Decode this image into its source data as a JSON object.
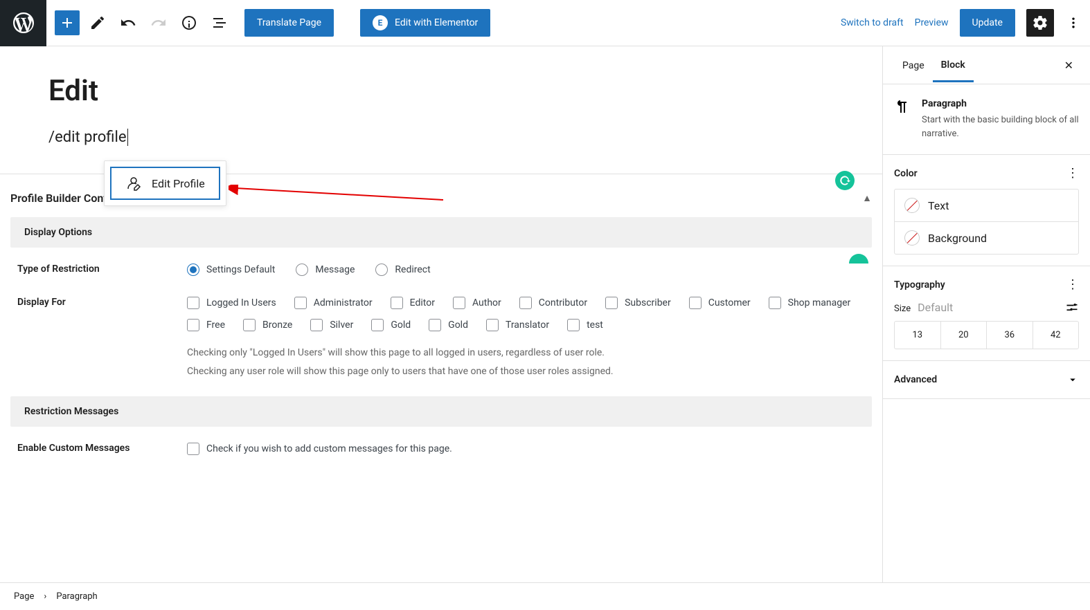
{
  "topbar": {
    "translate": "Translate Page",
    "elementor": "Edit with Elementor",
    "elementor_icon": "E",
    "switch_draft": "Switch to draft",
    "preview": "Preview",
    "update": "Update"
  },
  "editor": {
    "title": "Edit",
    "suggestion_label": "Edit Profile",
    "slash_text": "/edit profile"
  },
  "restriction": {
    "panel_title": "Profile Builder Content Restriction",
    "display_options": "Display Options",
    "type_label": "Type of Restriction",
    "types": [
      {
        "label": "Settings Default",
        "checked": true
      },
      {
        "label": "Message",
        "checked": false
      },
      {
        "label": "Redirect",
        "checked": false
      }
    ],
    "display_for_label": "Display For",
    "roles": [
      "Logged In Users",
      "Administrator",
      "Editor",
      "Author",
      "Contributor",
      "Subscriber",
      "Customer",
      "Shop manager",
      "Free",
      "Bronze",
      "Silver",
      "Gold",
      "Gold",
      "Translator",
      "test"
    ],
    "help1": "Checking only \"Logged In Users\" will show this page to all logged in users, regardless of user role.",
    "help2": "Checking any user role will show this page only to users that have one of those user roles assigned.",
    "messages_section": "Restriction Messages",
    "enable_messages_label": "Enable Custom Messages",
    "enable_messages_check": "Check if you wish to add custom messages for this page."
  },
  "sidebar": {
    "tabs": {
      "page": "Page",
      "block": "Block"
    },
    "block_name": "Paragraph",
    "block_desc": "Start with the basic building block of all narrative.",
    "color_section": "Color",
    "color_text": "Text",
    "color_bg": "Background",
    "typo_section": "Typography",
    "size_label": "Size",
    "size_default": "Default",
    "sizes": [
      "13",
      "20",
      "36",
      "42"
    ],
    "advanced": "Advanced"
  },
  "breadcrumb": {
    "root": "Page",
    "current": "Paragraph"
  }
}
